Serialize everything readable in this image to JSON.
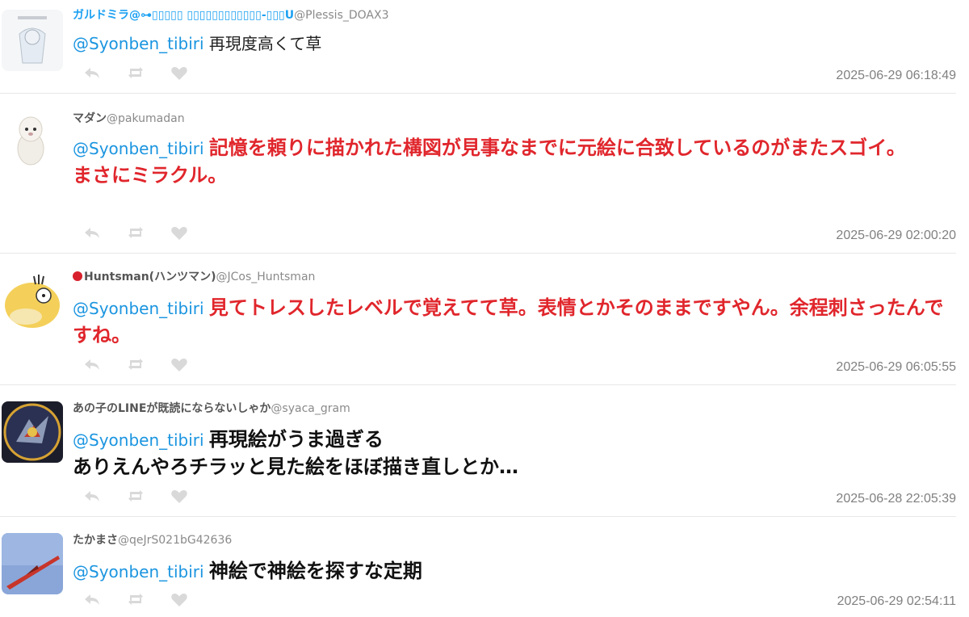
{
  "tweets": [
    {
      "name": "ガルドミラ@⊶▯▯▯▯▯ ▯▯▯▯▯▯▯▯▯▯▯▯-▯▯▯U",
      "handle": "@Plessis_DOAX3",
      "mention": "@Syonben_tibiri",
      "text": "再現度高くて草",
      "timestamp": "2025-06-29 06:18:49"
    },
    {
      "name": "マダン",
      "handle": "@pakumadan",
      "mention": "@Syonben_tibiri",
      "text": "記憶を頼りに描かれた構図が見事なまでに元絵に合致しているのがまたスゴイ。\nまさにミラクル。",
      "timestamp": "2025-06-29 02:00:20"
    },
    {
      "name": "Huntsman(ハンツマン)",
      "handle": "@JCos_Huntsman",
      "mention": "@Syonben_tibiri",
      "text": "見てトレスしたレベルで覚えてて草。表情とかそのままですやん。余程刺さったんですね。",
      "timestamp": "2025-06-29 06:05:55"
    },
    {
      "name": "あの子のLINEが既読にならないしゃか",
      "handle": "@syaca_gram",
      "mention": "@Syonben_tibiri",
      "text": "再現絵がうま過ぎる\nありえんやろチラッと見た絵をほぼ描き直しとか…",
      "timestamp": "2025-06-28 22:05:39"
    },
    {
      "name": "たかまさ",
      "handle": "@qeJrS021bG42636",
      "mention": "@Syonben_tibiri",
      "text": "神絵で神絵を探すな定期",
      "timestamp": "2025-06-29 02:54:11"
    }
  ],
  "icons": {
    "reply": "reply-icon",
    "retweet": "retweet-icon",
    "like": "heart-icon"
  },
  "colors": {
    "mention": "#1b95e0",
    "highlight_red": "#e0262c",
    "timestamp": "#808080",
    "action_icon": "#d9d9d9"
  }
}
